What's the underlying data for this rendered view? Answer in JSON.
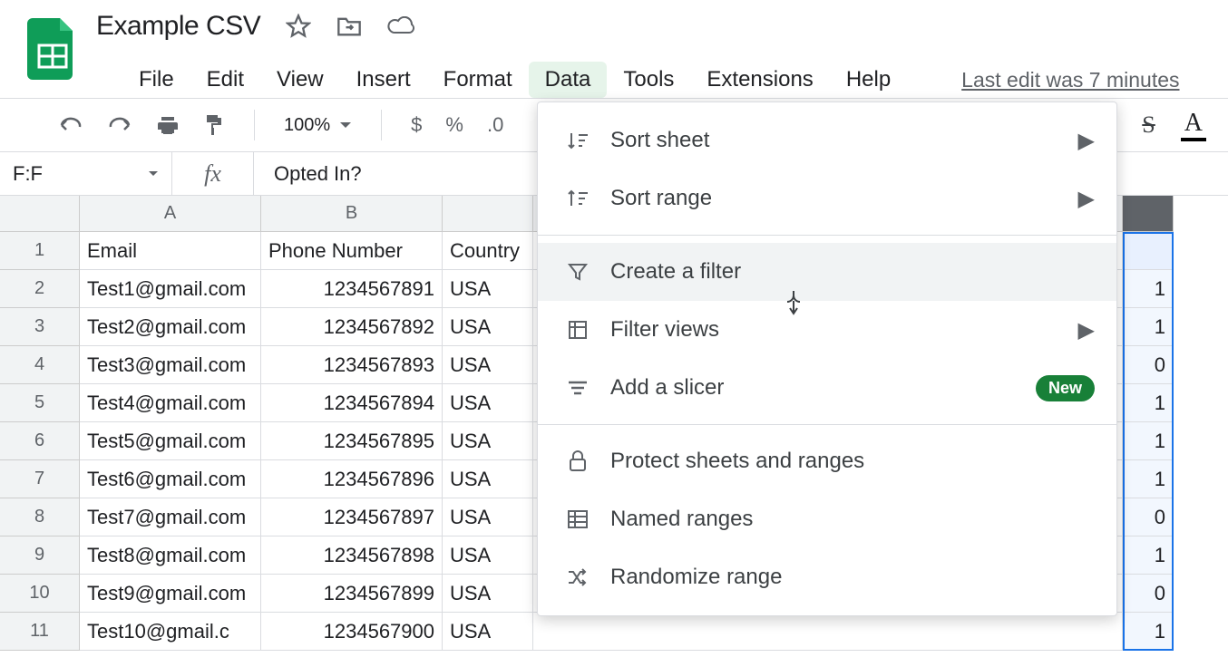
{
  "title": "Example CSV",
  "menu": {
    "file": "File",
    "edit": "Edit",
    "view": "View",
    "insert": "Insert",
    "format": "Format",
    "data": "Data",
    "tools": "Tools",
    "extensions": "Extensions",
    "help": "Help",
    "last_edit": "Last edit was 7 minutes"
  },
  "toolbar": {
    "zoom": "100%",
    "currency": "$",
    "percent": "%",
    "decimal": ".0"
  },
  "strikethrough_icon": "S",
  "formula": {
    "name_box": "F:F",
    "value": "Opted In?"
  },
  "columns": {
    "A": "A",
    "B": "B"
  },
  "rows": [
    "1",
    "2",
    "3",
    "4",
    "5",
    "6",
    "7",
    "8",
    "9",
    "10",
    "11"
  ],
  "headers": {
    "email": "Email",
    "phone": "Phone Number",
    "country": "Country"
  },
  "data": [
    {
      "email": "Test1@gmail.com",
      "phone": "1234567891",
      "country": "USA",
      "f": "1"
    },
    {
      "email": "Test2@gmail.com",
      "phone": "1234567892",
      "country": "USA",
      "f": "1"
    },
    {
      "email": "Test3@gmail.com",
      "phone": "1234567893",
      "country": "USA",
      "f": "0"
    },
    {
      "email": "Test4@gmail.com",
      "phone": "1234567894",
      "country": "USA",
      "f": "1"
    },
    {
      "email": "Test5@gmail.com",
      "phone": "1234567895",
      "country": "USA",
      "f": "1"
    },
    {
      "email": "Test6@gmail.com",
      "phone": "1234567896",
      "country": "USA",
      "f": "1"
    },
    {
      "email": "Test7@gmail.com",
      "phone": "1234567897",
      "country": "USA",
      "f": "0"
    },
    {
      "email": "Test8@gmail.com",
      "phone": "1234567898",
      "country": "USA",
      "f": "1"
    },
    {
      "email": "Test9@gmail.com",
      "phone": "1234567899",
      "country": "USA",
      "f": "0"
    },
    {
      "email": "Test10@gmail.c",
      "phone": "1234567900",
      "country": "USA",
      "f": "1"
    }
  ],
  "dropdown": {
    "sort_sheet": "Sort sheet",
    "sort_range": "Sort range",
    "create_filter": "Create a filter",
    "filter_views": "Filter views",
    "add_slicer": "Add a slicer",
    "new_badge": "New",
    "protect": "Protect sheets and ranges",
    "named_ranges": "Named ranges",
    "randomize": "Randomize range"
  }
}
